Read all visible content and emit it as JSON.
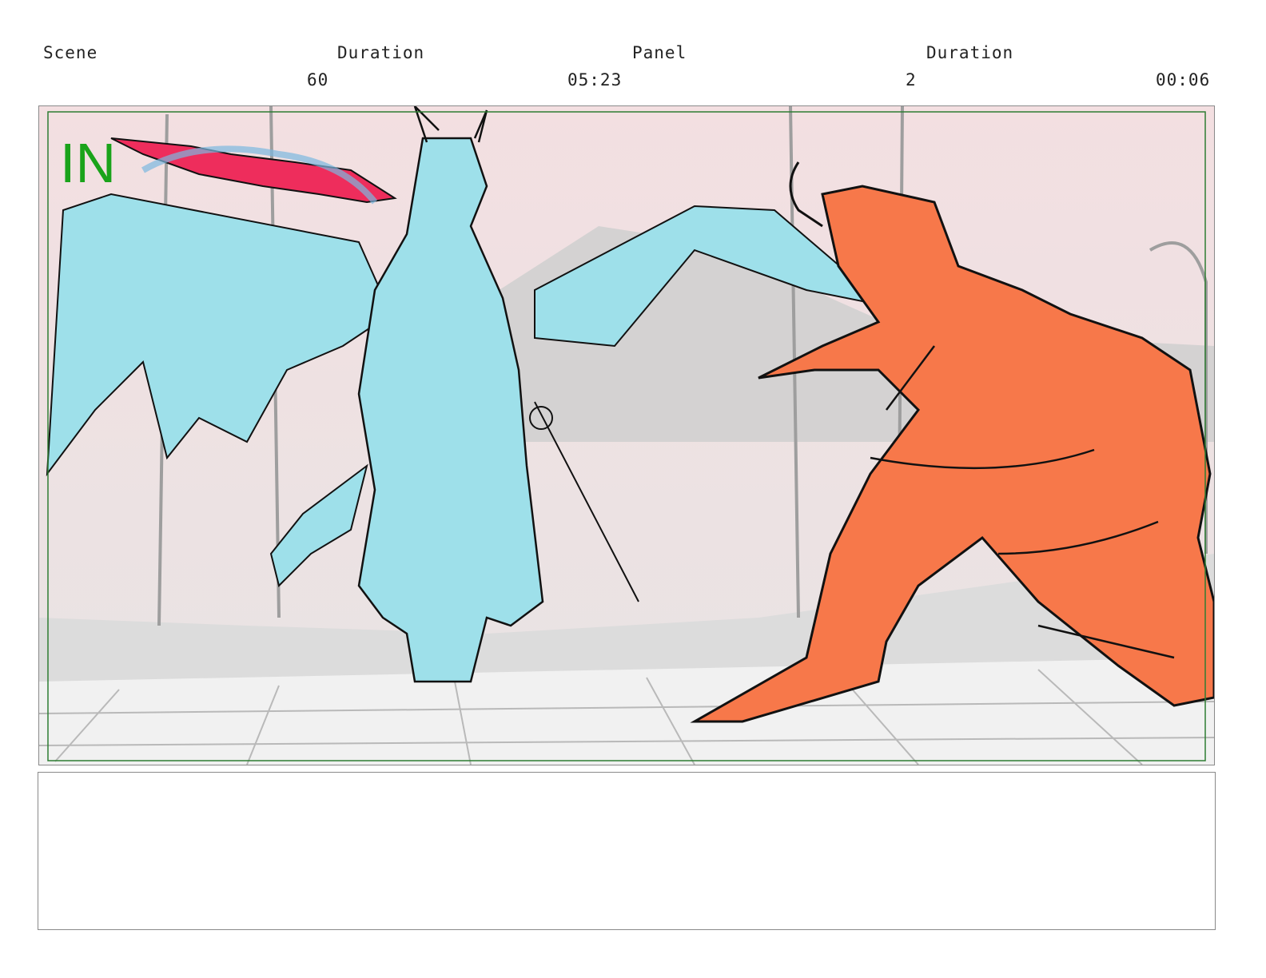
{
  "header": {
    "scene_label": "Scene",
    "scene_duration_label": "Duration",
    "panel_label": "Panel",
    "panel_duration_label": "Duration",
    "scene_value": "60",
    "scene_duration_value": "05:23",
    "panel_value": "2",
    "panel_duration_value": "00:06"
  },
  "panel_frame": {
    "marker_text": "IN",
    "colors": {
      "sky": "#f2e0e2",
      "ground": "#eeeeee",
      "blue_character": "#9ee0ea",
      "orange_character": "#f7784a",
      "weapon": "#ee2d5c",
      "safe_area": "#2e7d32",
      "marker": "#1aa31a"
    }
  },
  "notes": {
    "text": ""
  }
}
